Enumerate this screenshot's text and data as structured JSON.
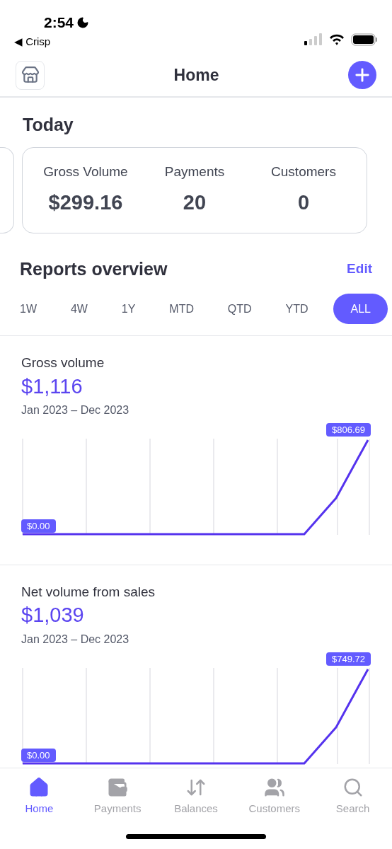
{
  "status_bar": {
    "time": "2:54",
    "back_label": "◀ Crisp"
  },
  "header": {
    "title": "Home"
  },
  "today": {
    "title": "Today",
    "stats": [
      {
        "label": "Gross Volume",
        "value": "$299.16"
      },
      {
        "label": "Payments",
        "value": "20"
      },
      {
        "label": "Customers",
        "value": "0"
      }
    ]
  },
  "reports": {
    "title": "Reports overview",
    "edit": "Edit",
    "periods": [
      {
        "label": "1W",
        "selected": false
      },
      {
        "label": "4W",
        "selected": false
      },
      {
        "label": "1Y",
        "selected": false
      },
      {
        "label": "MTD",
        "selected": false
      },
      {
        "label": "QTD",
        "selected": false
      },
      {
        "label": "YTD",
        "selected": false
      },
      {
        "label": "ALL",
        "selected": true
      }
    ]
  },
  "charts": [
    {
      "title": "Gross volume",
      "total": "$1,116",
      "range": "Jan 2023 – Dec 2023",
      "start_label": "$0.00",
      "end_label": "$806.69"
    },
    {
      "title": "Net volume from sales",
      "total": "$1,039",
      "range": "Jan 2023 – Dec 2023",
      "start_label": "$0.00",
      "end_label": "$749.72"
    }
  ],
  "tab_bar": [
    {
      "label": "Home",
      "selected": true
    },
    {
      "label": "Payments",
      "selected": false
    },
    {
      "label": "Balances",
      "selected": false
    },
    {
      "label": "Customers",
      "selected": false
    },
    {
      "label": "Search",
      "selected": false
    }
  ]
}
